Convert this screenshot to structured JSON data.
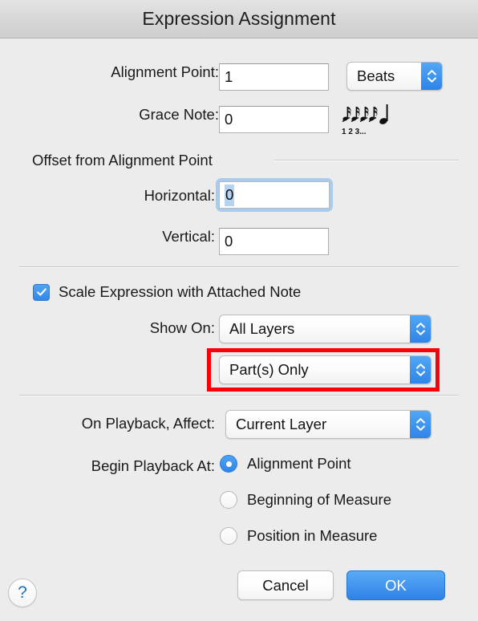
{
  "window": {
    "title": "Expression Assignment"
  },
  "fields": {
    "alignment_point": {
      "label": "Alignment Point:",
      "value": "1",
      "unit_label": "Beats"
    },
    "grace_note": {
      "label": "Grace Note:",
      "value": "0",
      "icon": "grace-note-glyph",
      "icon_caption": "1 2 3..."
    }
  },
  "offset_group": {
    "title": "Offset from Alignment Point",
    "horizontal": {
      "label": "Horizontal:",
      "value": "0",
      "focused": true,
      "selected": true
    },
    "vertical": {
      "label": "Vertical:",
      "value": "0"
    }
  },
  "scale_section": {
    "checkbox": {
      "label": "Scale Expression with Attached Note",
      "checked": true
    },
    "show_on": {
      "label": "Show On:",
      "value": "All Layers"
    },
    "score_parts": {
      "value": "Part(s) Only",
      "highlighted": true
    }
  },
  "playback_section": {
    "affect": {
      "label": "On Playback, Affect:",
      "value": "Current Layer"
    },
    "begin_at": {
      "label": "Begin Playback At:",
      "options": [
        {
          "label": "Alignment Point",
          "selected": true
        },
        {
          "label": "Beginning of Measure",
          "selected": false
        },
        {
          "label": "Position in Measure",
          "selected": false
        }
      ]
    }
  },
  "footer": {
    "help_label": "?",
    "cancel_label": "Cancel",
    "ok_label": "OK"
  },
  "colors": {
    "accent_blue": "#2f84e8",
    "annotation_red": "#fb0007",
    "focus_ring": "#a9cbef",
    "window_bg": "#ececec"
  }
}
